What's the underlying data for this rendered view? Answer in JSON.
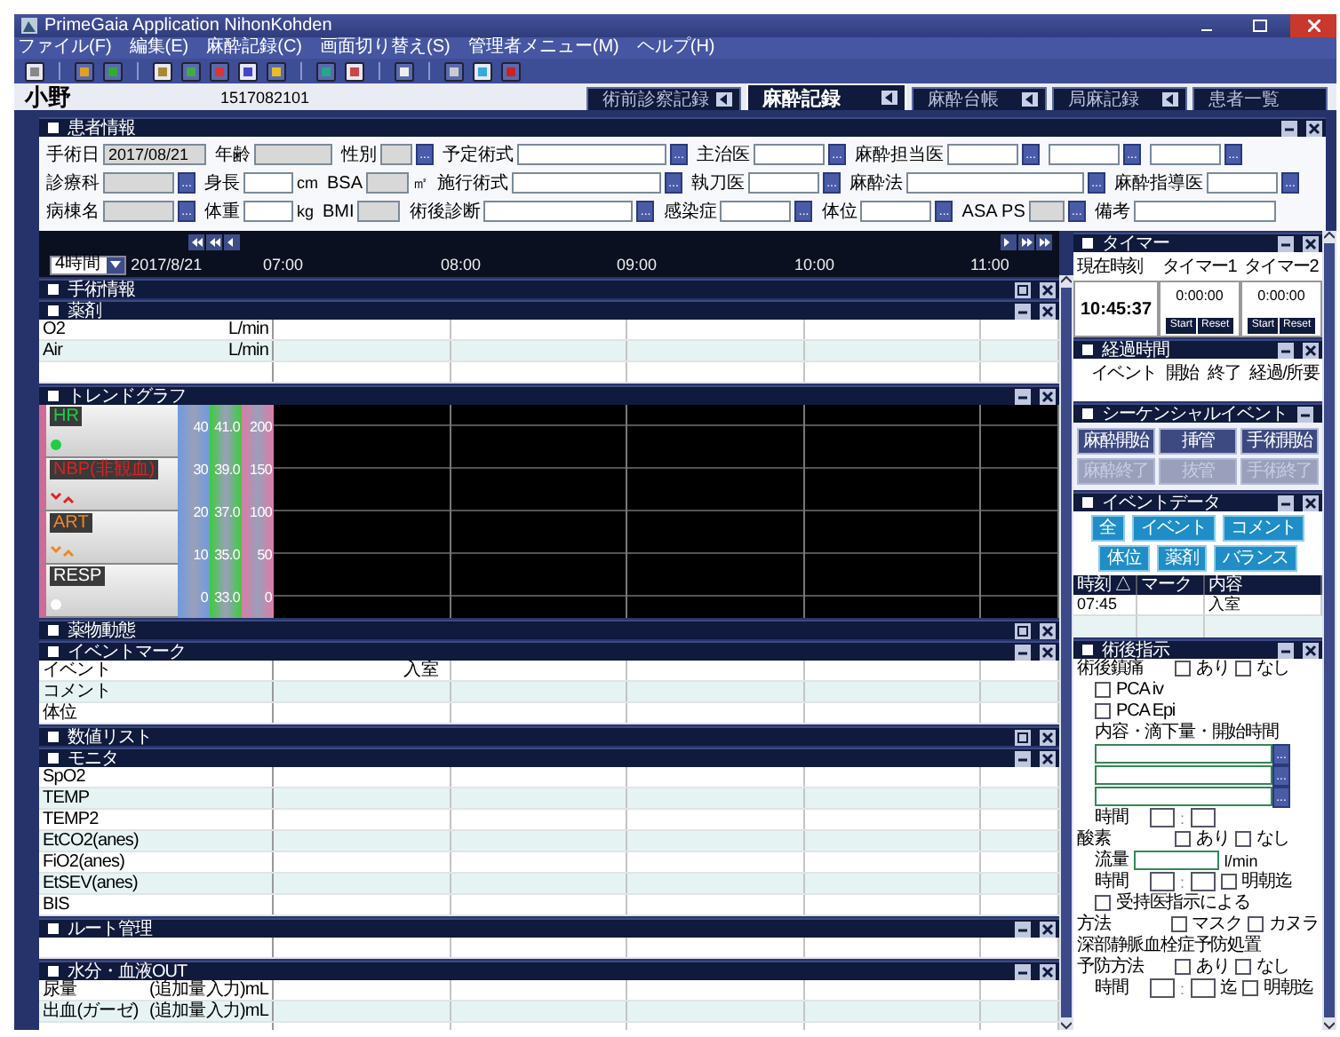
{
  "window": {
    "title": "PrimeGaia Application NihonKohden"
  },
  "menu": [
    "ファイル(F)",
    "編集(E)",
    "麻酔記録(C)",
    "画面切り替え(S)",
    "管理者メニュー(M)",
    "ヘルプ(H)"
  ],
  "patient": {
    "name": "小野",
    "id": "1517082101"
  },
  "tabs": [
    {
      "label": "術前診察記録",
      "selected": false
    },
    {
      "label": "麻酔記録",
      "selected": true
    },
    {
      "label": "麻酔台帳",
      "selected": false
    },
    {
      "label": "局麻記録",
      "selected": false
    },
    {
      "label": "患者一覧",
      "selected": false
    }
  ],
  "patient_info": {
    "title": "患者情報",
    "rows": [
      {
        "fields": [
          {
            "label": "手術日",
            "value": "2017/08/21",
            "readonly": true
          },
          {
            "label": "年齢",
            "readonly": true
          },
          {
            "label": "性別",
            "readonly": true,
            "button": "..."
          },
          {
            "label": "予定術式",
            "readonly": false,
            "button": "..."
          },
          {
            "label": "主治医",
            "readonly": false,
            "button": "..."
          },
          {
            "label": "麻酔担当医",
            "readonly": false,
            "button": "..."
          },
          {
            "readonly": false,
            "button": "..."
          },
          {
            "readonly": false,
            "button": "..."
          }
        ]
      },
      {
        "fields": [
          {
            "label": "診療科",
            "readonly": true,
            "button": "..."
          },
          {
            "label": "身長",
            "readonly": false,
            "unit": "cm"
          },
          {
            "label": "BSA",
            "readonly": true,
            "unit": "㎡"
          },
          {
            "label": "施行術式",
            "readonly": false,
            "button": "..."
          },
          {
            "label": "執刀医",
            "readonly": false,
            "button": "..."
          },
          {
            "label": "麻酔法",
            "readonly": false,
            "button": "..."
          },
          {
            "label": "麻酔指導医",
            "readonly": false,
            "button": "..."
          }
        ]
      },
      {
        "fields": [
          {
            "label": "病棟名",
            "readonly": true,
            "button": "..."
          },
          {
            "label": "体重",
            "readonly": false,
            "unit": "kg"
          },
          {
            "label": "BMI",
            "readonly": true
          },
          {
            "label": "術後診断",
            "readonly": false,
            "button": "..."
          },
          {
            "label": "感染症",
            "readonly": false,
            "button": "..."
          },
          {
            "label": "体位",
            "readonly": false,
            "button": "..."
          },
          {
            "label": "ASA PS",
            "readonly": true,
            "button": "..."
          },
          {
            "label": "備考",
            "readonly": false
          }
        ]
      }
    ]
  },
  "timeline": {
    "range": "4時間",
    "date": "2017/8/21",
    "times": [
      "07:00",
      "08:00",
      "09:00",
      "10:00",
      "11:00"
    ]
  },
  "sections": [
    {
      "kind": "header",
      "title": "手術情報",
      "expanded": false
    },
    {
      "kind": "grid",
      "title": "薬剤",
      "expanded": true,
      "rows": [
        {
          "label": "O2",
          "unit": "L/min"
        },
        {
          "label": "Air",
          "unit": "L/min"
        }
      ],
      "blank_row": true
    },
    {
      "kind": "trend",
      "title": "トレンドグラフ",
      "expanded": true,
      "channels": [
        {
          "name": "HR",
          "color": "#22cc44",
          "kind": "dot"
        },
        {
          "name": "NBP(非観血)",
          "color": "#dd2222",
          "kind": "chevrons"
        },
        {
          "name": "ART",
          "color": "#ee8822",
          "kind": "chevrons"
        },
        {
          "name": "RESP",
          "color": "#ffffff",
          "kind": "dot"
        }
      ],
      "scales": [
        {
          "color": "#6f9ae0",
          "ticks": [
            "40",
            "30",
            "20",
            "10",
            "0"
          ]
        },
        {
          "color": "#3ccc3c",
          "ticks": [
            "41.0",
            "39.0",
            "37.0",
            "35.0",
            "33.0"
          ]
        },
        {
          "color": "#de7aa6",
          "ticks": [
            "200",
            "150",
            "100",
            "50",
            "0"
          ]
        }
      ]
    },
    {
      "kind": "header",
      "title": "薬物動態",
      "expanded": false
    },
    {
      "kind": "grid",
      "title": "イベントマーク",
      "expanded": true,
      "rows": [
        {
          "label": "イベント",
          "entry": "入室"
        },
        {
          "label": "コメント"
        },
        {
          "label": "体位"
        }
      ],
      "blank_row": false
    },
    {
      "kind": "header",
      "title": "数値リスト",
      "expanded": false
    },
    {
      "kind": "grid",
      "title": "モニタ",
      "expanded": true,
      "rows": [
        {
          "label": "SpO2"
        },
        {
          "label": "TEMP"
        },
        {
          "label": "TEMP2"
        },
        {
          "label": "EtCO2(anes)"
        },
        {
          "label": "FiO2(anes)"
        },
        {
          "label": "EtSEV(anes)"
        },
        {
          "label": "BIS"
        }
      ],
      "blank_row": false
    },
    {
      "kind": "grid",
      "title": "ルート管理",
      "expanded": true,
      "blank_row": true
    },
    {
      "kind": "grid",
      "title": "水分・血液OUT",
      "expanded": true,
      "rows": [
        {
          "label": "尿量",
          "unit": "(追加量入力)mL"
        },
        {
          "label": "出血(ガーゼ)",
          "unit": "(追加量入力)mL"
        }
      ],
      "blank_row": true
    }
  ],
  "timer": {
    "title": "タイマー",
    "expanded": true,
    "headers": [
      "現在時刻",
      "タイマー1",
      "タイマー2"
    ],
    "clock": "10:45:37",
    "timers": [
      {
        "value": "0:00:00",
        "buttons": [
          "Start",
          "Reset"
        ]
      },
      {
        "value": "0:00:00",
        "buttons": [
          "Start",
          "Reset"
        ]
      }
    ]
  },
  "elapsed": {
    "title": "経過時間",
    "expanded": true,
    "columns": [
      "イベント",
      "開始",
      "終了",
      "経過/所要"
    ]
  },
  "sequential": {
    "title": "シーケンシャルイベント",
    "expanded": true,
    "buttons": [
      {
        "label": "麻酔開始",
        "disabled": false
      },
      {
        "label": "挿管",
        "disabled": false
      },
      {
        "label": "手術開始",
        "disabled": false
      },
      {
        "label": "麻酔終了",
        "disabled": true
      },
      {
        "label": "抜管",
        "disabled": true
      },
      {
        "label": "手術終了",
        "disabled": true
      }
    ]
  },
  "event_data": {
    "title": "イベントデータ",
    "expanded": true,
    "filters": [
      "全",
      "イベント",
      "コメント",
      "体位",
      "薬剤",
      "バランス"
    ],
    "columns": [
      "時刻 △",
      "マーク",
      "内容"
    ],
    "rows": [
      {
        "time": "07:45",
        "content": "入室"
      }
    ],
    "blank_row": true
  },
  "postop": {
    "title": "術後指示",
    "expanded": true,
    "items": [
      {
        "kind": "choice",
        "label": "術後鎮痛",
        "options": [
          {
            "label": "あり",
            "checked": false
          },
          {
            "label": "なし",
            "checked": false
          }
        ]
      },
      {
        "kind": "check",
        "label": "PCA iv",
        "checked": false
      },
      {
        "kind": "check",
        "label": "PCA Epi",
        "checked": false
      },
      {
        "kind": "caption",
        "label": "内容・滴下量・開始時間"
      },
      {
        "kind": "picker",
        "button": "..."
      },
      {
        "kind": "picker",
        "button": "..."
      },
      {
        "kind": "picker",
        "button": "..."
      },
      {
        "kind": "time",
        "label": "時間",
        "separator": ":"
      },
      {
        "kind": "choice",
        "label": "酸素",
        "options": [
          {
            "label": "あり",
            "checked": false
          },
          {
            "label": "なし",
            "checked": false
          }
        ]
      },
      {
        "kind": "flow",
        "label": "流量",
        "unit": "l/min"
      },
      {
        "kind": "time",
        "label": "時間",
        "separator": ":",
        "option": {
          "label": "明朝迄",
          "checked": false
        }
      },
      {
        "kind": "check",
        "label": "受持医指示による",
        "checked": false
      },
      {
        "kind": "choice",
        "label": "方法",
        "options": [
          {
            "label": "マスク",
            "checked": false
          },
          {
            "label": "カヌラ",
            "checked": false
          }
        ]
      },
      {
        "kind": "heading",
        "label": "深部静脈血栓症予防処置"
      },
      {
        "kind": "choice",
        "label": "予防方法",
        "options": [
          {
            "label": "あり",
            "checked": false
          },
          {
            "label": "なし",
            "checked": false
          }
        ]
      },
      {
        "kind": "time",
        "label": "時間",
        "separator": ":",
        "suffix": "迄",
        "option": {
          "label": "明朝迄",
          "checked": false
        }
      }
    ]
  }
}
